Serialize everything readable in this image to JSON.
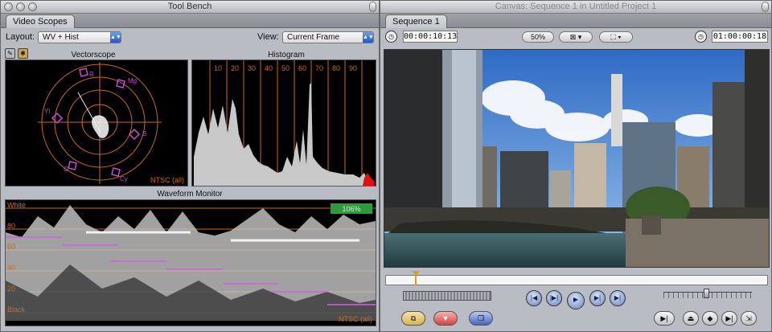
{
  "toolbench": {
    "title": "Tool Bench",
    "tab": "Video Scopes",
    "layout_label": "Layout:",
    "layout_value": "WV + Hist",
    "view_label": "View:",
    "view_value": "Current Frame",
    "vectorscope": {
      "title": "Vectorscope",
      "standard": "NTSC (all)",
      "targets": [
        "R",
        "Mg",
        "B",
        "Cy",
        "G",
        "Yl"
      ]
    },
    "histogram": {
      "title": "Histogram",
      "ticks": [
        "10",
        "20",
        "30",
        "40",
        "50",
        "60",
        "70",
        "80",
        "90"
      ]
    },
    "waveform": {
      "title": "Waveform Monitor",
      "badge": "106%",
      "standard": "NTSC (all)",
      "labels": [
        "White",
        "80",
        "60",
        "40",
        "20",
        "Black"
      ]
    }
  },
  "canvas": {
    "title": "Canvas: Sequence 1 in Untitled Project 1",
    "tab": "Sequence 1",
    "timecode_duration": "00:00:10:13",
    "zoom": "50%",
    "timecode_current": "01:00:00:18"
  },
  "colors": {
    "graticule": "#c86a22",
    "target": "#c050d0",
    "badge": "#2d9a3c"
  }
}
